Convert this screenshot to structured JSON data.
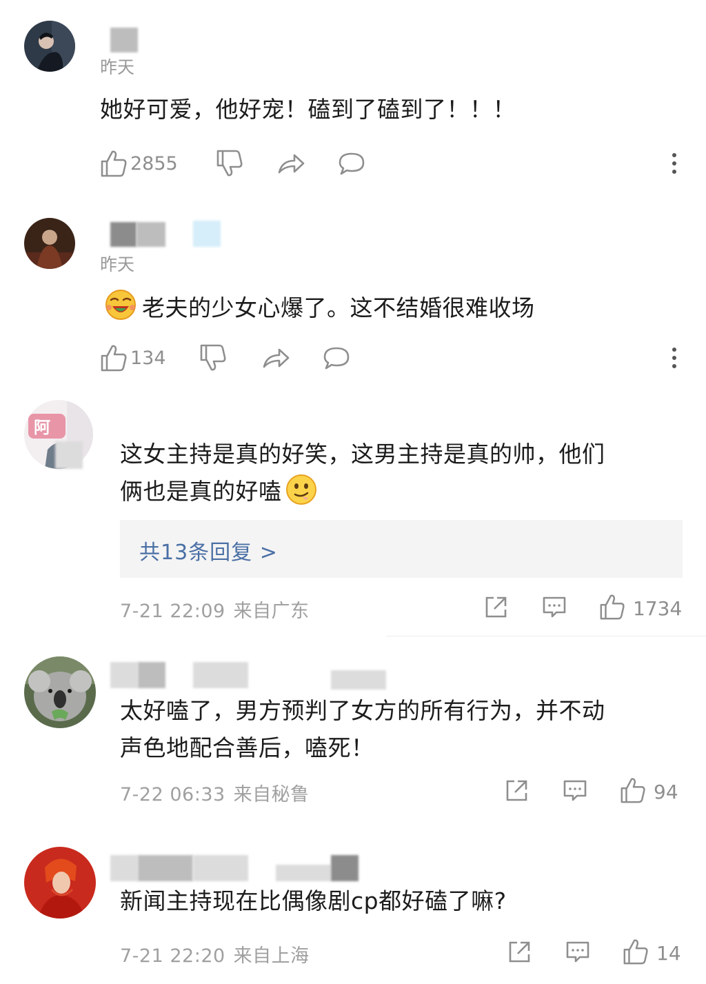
{
  "comments_a": [
    {
      "time": "昨天",
      "text": "她好可爱，他好宠！磕到了磕到了！！！",
      "like_count": "2855"
    },
    {
      "time": "昨天",
      "text": "老夫的少女心爆了。这不结婚很难收场",
      "like_count": "134"
    }
  ],
  "comments_b": [
    {
      "text_line1": "这女主持是真的好笑，这男主持是真的帅，他们",
      "text_line2": "俩也是真的好嗑",
      "reply_label": "共13条回复 >",
      "date": "7-21 22:09",
      "location": "来自广东",
      "like_count": "1734"
    },
    {
      "text_line1": "太好嗑了，男方预判了女方的所有行为，并不动",
      "text_line2": "声色地配合善后，嗑死！",
      "date": "7-22 06:33",
      "location": "来自秘鲁",
      "like_count": "94"
    },
    {
      "text_line1": "新闻主持现在比偶像剧cp都好磕了嘛?",
      "date": "7-21 22:20",
      "location": "来自上海",
      "like_count": "14"
    }
  ],
  "icons": {
    "like": "thumbs-up-icon",
    "dislike": "thumbs-down-icon",
    "share": "share-arrow-icon",
    "comment": "comment-bubble-icon",
    "more": "more-vertical-icon",
    "forward": "forward-box-icon",
    "reply": "reply-bubble-icon"
  },
  "colors": {
    "reply_link": "#4a6fa5",
    "meta_text": "#a0a0a0",
    "reply_bg": "#f4f4f4"
  }
}
